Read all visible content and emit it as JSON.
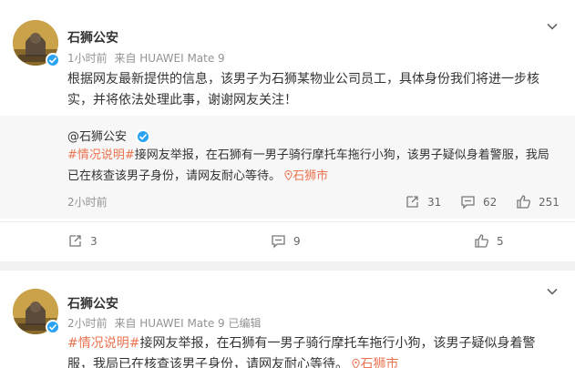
{
  "post1": {
    "author": "石狮公安",
    "time": "1小时前",
    "source": "来自 HUAWEI Mate 9",
    "text": "根据网友最新提供的信息，该男子为石狮某物业公司员工，具体身份我们将进一步核实，并将依法处理此事，谢谢网友关注！",
    "repost": {
      "author": "@石狮公安",
      "tag": "#情况说明#",
      "text": "接网友举报，在石狮有一男子骑行摩托车拖行小狗，该男子疑似身着警服，我局已在核查该男子身份，请网友耐心等待。",
      "location": "石狮市",
      "time": "2小时前",
      "reposts": "31",
      "comments": "62",
      "likes": "251"
    },
    "reposts": "3",
    "comments": "9",
    "likes": "5"
  },
  "post2": {
    "author": "石狮公安",
    "time": "2小时前",
    "source": "来自 HUAWEI Mate 9 已编辑",
    "tag": "#情况说明#",
    "text": "接网友举报，在石狮有一男子骑行摩托车拖行小狗，该男子疑似身着警服，我局已在核查该男子身份，请网友耐心等待。",
    "location": "石狮市"
  },
  "colors": {
    "accent": "#eb7350",
    "verified": "#2ba3f3",
    "muted": "#939393"
  },
  "icons": [
    "chevron-down-icon",
    "verified-icon",
    "repost-icon",
    "comment-icon",
    "like-icon",
    "location-pin-icon"
  ]
}
